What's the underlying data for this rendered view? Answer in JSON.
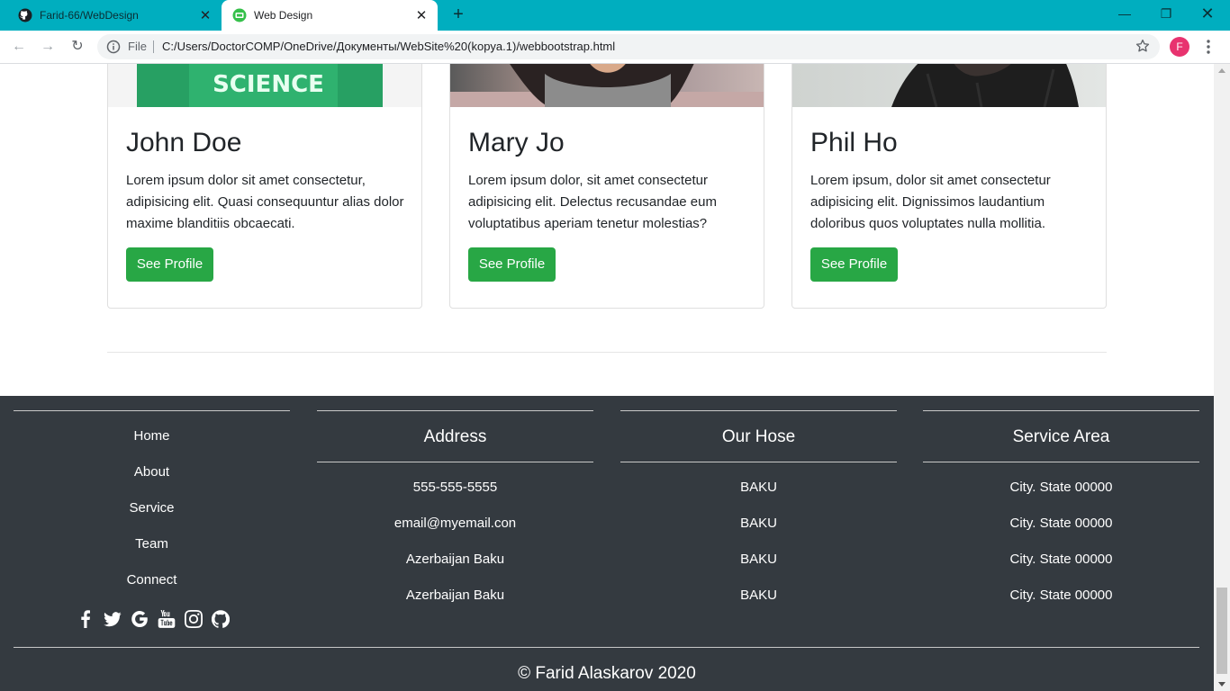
{
  "browser": {
    "tabs": [
      {
        "title": "Farid-66/WebDesign",
        "active": false
      },
      {
        "title": "Web Design",
        "active": true
      }
    ],
    "address_label": "File",
    "url": "C:/Users/DoctorCOMP/OneDrive/Документы/WebSite%20(kopya.1)/webbootstrap.html",
    "profile_initial": "F",
    "colors": {
      "tabbar": "#00aebf",
      "profile": "#e8336f"
    }
  },
  "team": {
    "cards": [
      {
        "name": "John Doe",
        "text": "Lorem ipsum dolor sit amet consectetur, adipisicing elit. Quasi consequuntur alias dolor maxime blanditiis obcaecati.",
        "button": "See Profile",
        "shirt_text": "SCIENCE"
      },
      {
        "name": "Mary Jo",
        "text": "Lorem ipsum dolor, sit amet consectetur adipisicing elit. Delectus recusandae eum voluptatibus aperiam tenetur molestias?",
        "button": "See Profile"
      },
      {
        "name": "Phil Ho",
        "text": "Lorem ipsum, dolor sit amet consectetur adipisicing elit. Dignissimos laudantium doloribus quos voluptates nulla mollitia.",
        "button": "See Profile"
      }
    ],
    "button_color": "#28a745"
  },
  "footer": {
    "nav": [
      "Home",
      "About",
      "Service",
      "Team",
      "Connect"
    ],
    "social_icons": [
      "facebook-icon",
      "twitter-icon",
      "google-icon",
      "youtube-icon",
      "instagram-icon",
      "github-icon"
    ],
    "columns": [
      {
        "heading": "Address",
        "items": [
          "555-555-5555",
          "email@myemail.con",
          "Azerbaijan Baku",
          "Azerbaijan Baku"
        ]
      },
      {
        "heading": "Our Hose",
        "items": [
          "BAKU",
          "BAKU",
          "BAKU",
          "BAKU"
        ]
      },
      {
        "heading": "Service Area",
        "items": [
          "City. State 00000",
          "City. State 00000",
          "City. State 00000",
          "City. State 00000"
        ]
      }
    ],
    "copyright": "© Farid Alaskarov 2020",
    "background": "#343a40"
  }
}
